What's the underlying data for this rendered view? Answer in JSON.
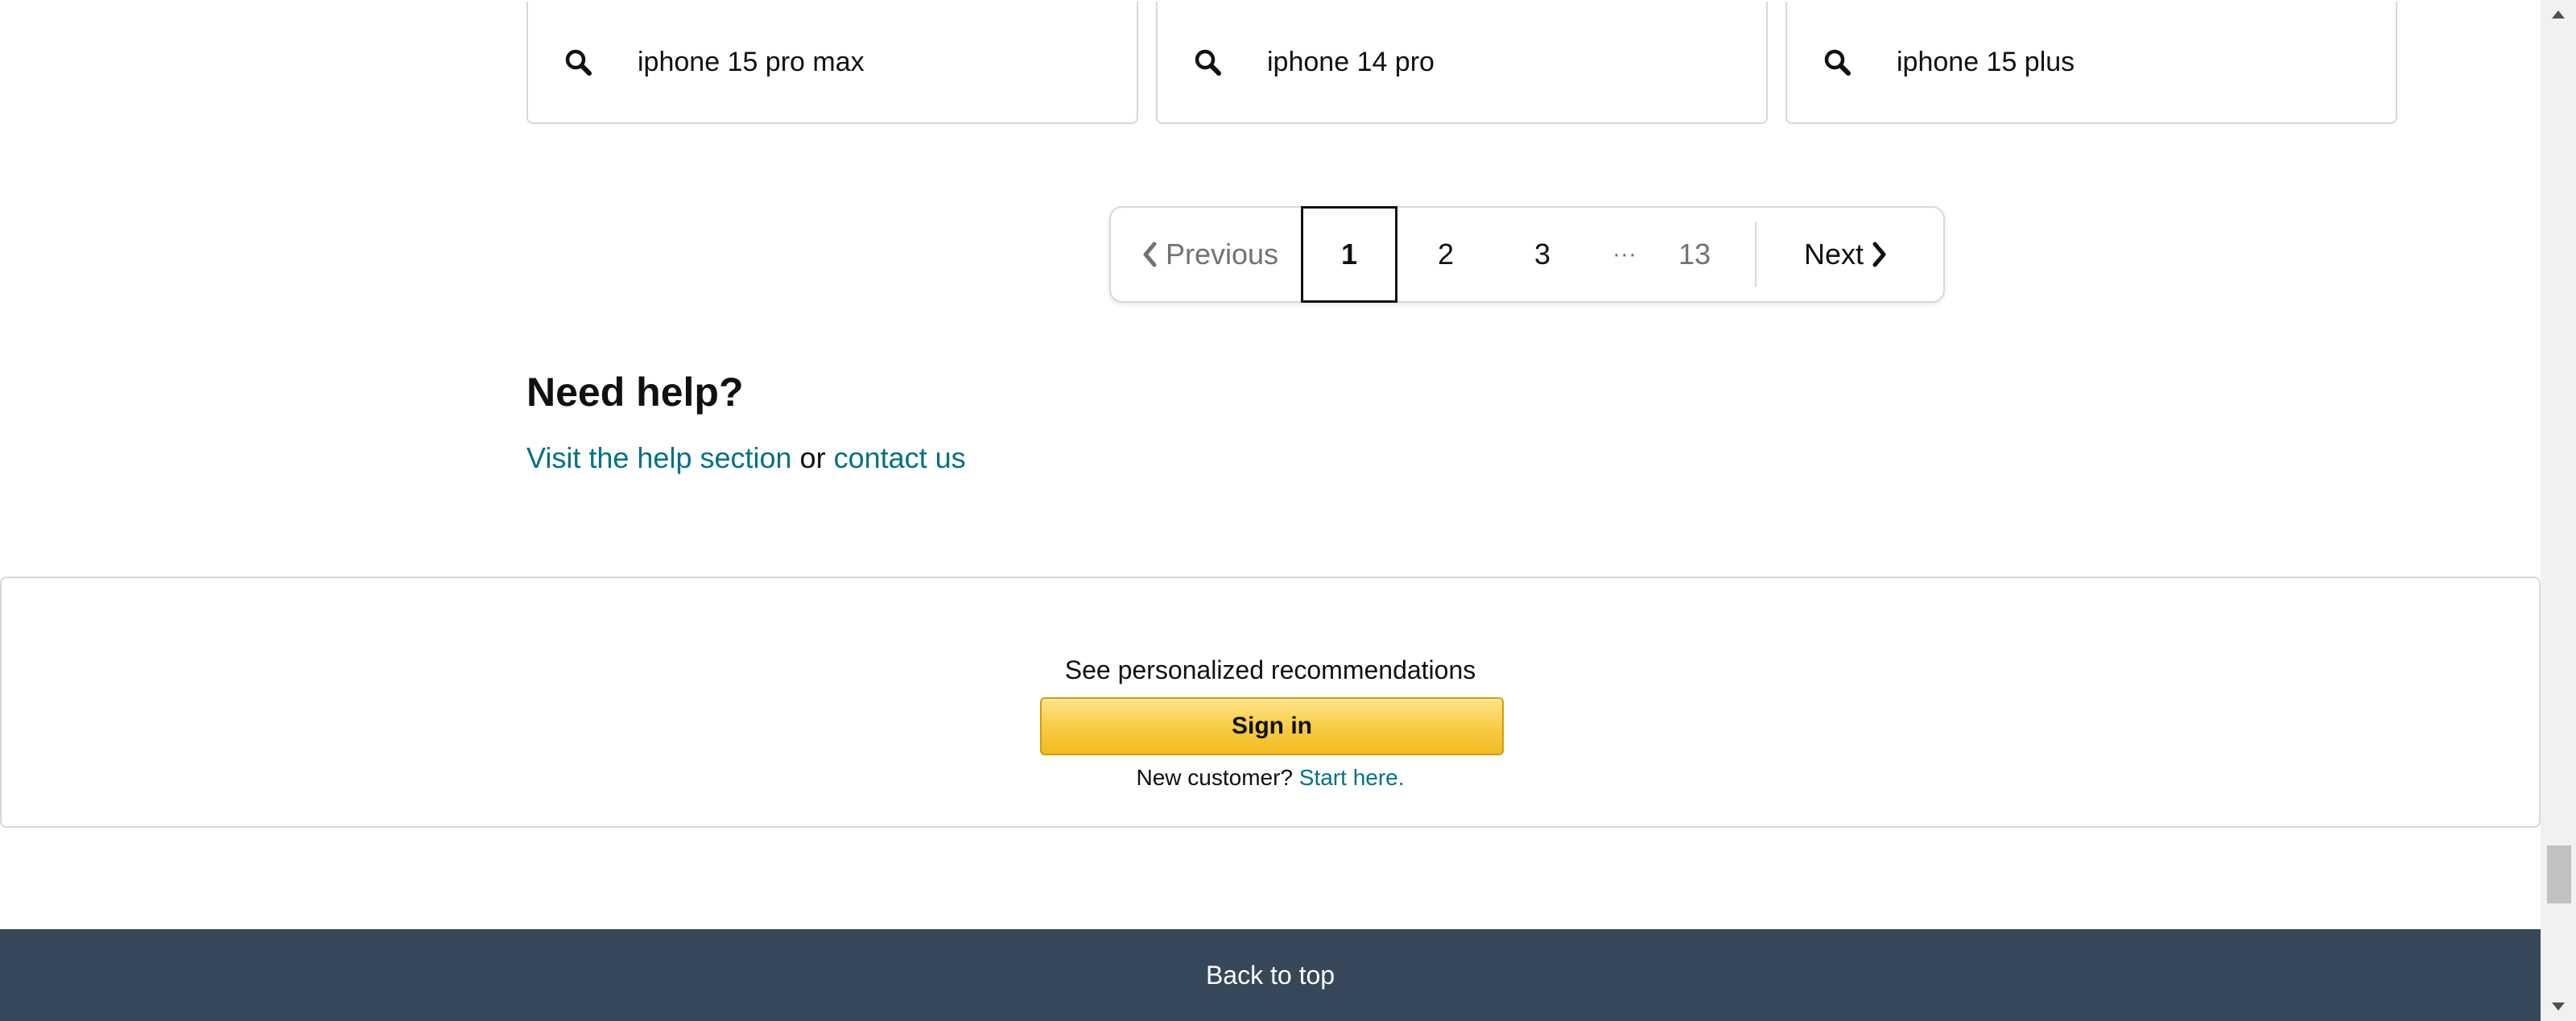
{
  "related_searches": [
    {
      "label": "iphone 15 pro max",
      "icon": "search-icon"
    },
    {
      "label": "iphone 14 pro",
      "icon": "search-icon"
    },
    {
      "label": "iphone 15 plus",
      "icon": "search-icon"
    }
  ],
  "pagination": {
    "previous_label": "Previous",
    "current_page": "1",
    "pages": [
      "2",
      "3"
    ],
    "ellipsis": "···",
    "last_page": "13",
    "next_label": "Next"
  },
  "help": {
    "title": "Need help?",
    "help_link": "Visit the help section",
    "connector": " or ",
    "contact_link": "contact us"
  },
  "recommendations": {
    "title": "See personalized recommendations",
    "signin_label": "Sign in",
    "new_customer_text": "New customer? ",
    "start_link": "Start here."
  },
  "footer": {
    "back_to_top": "Back to top"
  },
  "colors": {
    "link": "#007185",
    "signin_button": "#f7ca44",
    "footer_bg": "#37475a"
  }
}
